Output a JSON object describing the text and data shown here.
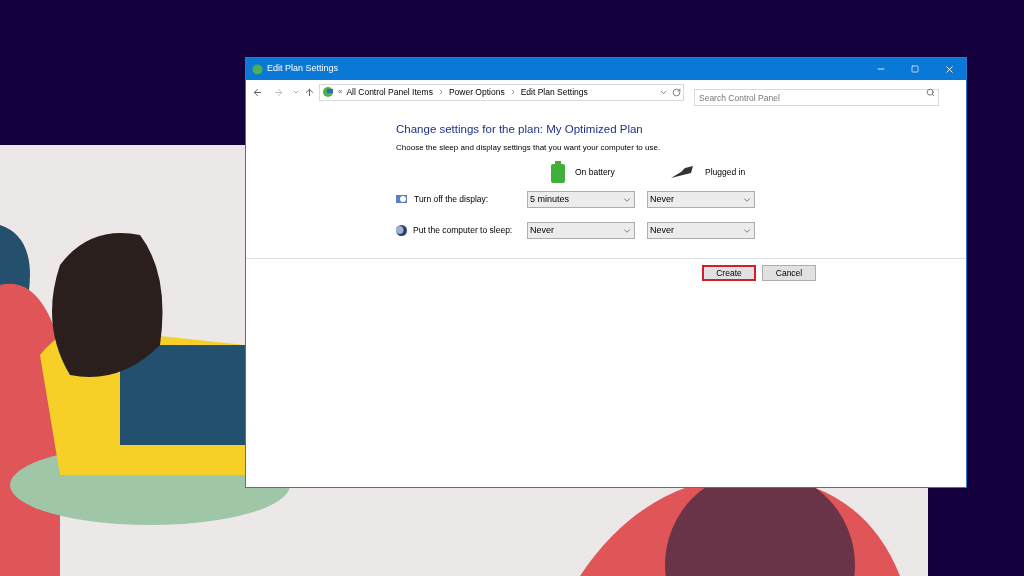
{
  "window": {
    "title": "Edit Plan Settings"
  },
  "address_bar": {
    "overflow": "«",
    "crumbs": [
      "All Control Panel Items",
      "Power Options",
      "Edit Plan Settings"
    ]
  },
  "search": {
    "placeholder": "Search Control Panel"
  },
  "heading": "Change settings for the plan: My Optimized Plan",
  "description": "Choose the sleep and display settings that you want your computer to use.",
  "columns": [
    {
      "kind": "battery",
      "label": "On battery"
    },
    {
      "kind": "plug",
      "label": "Plugged in"
    }
  ],
  "settings": [
    {
      "kind": "display",
      "label": "Turn off the display:",
      "values": [
        "5 minutes",
        "Never"
      ]
    },
    {
      "kind": "sleep",
      "label": "Put the computer to sleep:",
      "values": [
        "Never",
        "Never"
      ]
    }
  ],
  "buttons": [
    {
      "label": "Create",
      "highlighted": true
    },
    {
      "label": "Cancel",
      "highlighted": false
    }
  ]
}
